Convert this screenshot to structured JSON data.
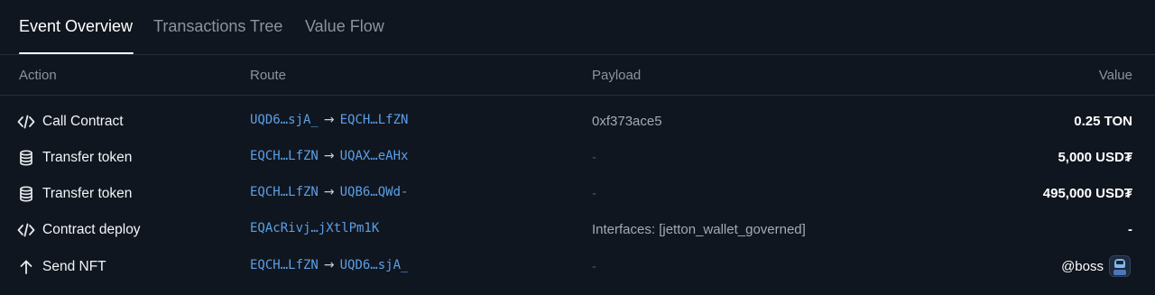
{
  "tabs": [
    {
      "label": "Event Overview",
      "active": true
    },
    {
      "label": "Transactions Tree",
      "active": false
    },
    {
      "label": "Value Flow",
      "active": false
    }
  ],
  "columns": {
    "action": "Action",
    "route": "Route",
    "payload": "Payload",
    "value": "Value"
  },
  "rows": [
    {
      "icon": "code-icon",
      "action": "Call Contract",
      "from": "UQD6…sjA_",
      "to": "EQCH…LfZN",
      "payload": "0xf373ace5",
      "value": "0.25 TON"
    },
    {
      "icon": "database-icon",
      "action": "Transfer token",
      "from": "EQCH…LfZN",
      "to": "UQAX…eAHx",
      "payload": "-",
      "value": "5,000 USD₮"
    },
    {
      "icon": "database-icon",
      "action": "Transfer token",
      "from": "EQCH…LfZN",
      "to": "UQB6…QWd-",
      "payload": "-",
      "value": "495,000 USD₮"
    },
    {
      "icon": "code-icon",
      "action": "Contract deploy",
      "address": "EQAcRivj…jXtlPm1K",
      "payload": "Interfaces: [jetton_wallet_governed]",
      "value": "-"
    },
    {
      "icon": "arrow-up-icon",
      "action": "Send NFT",
      "from": "EQCH…LfZN",
      "to": "UQD6…sjA_",
      "payload": "-",
      "value": "@boss"
    }
  ],
  "route_arrow": "→",
  "colors": {
    "background": "#10161f",
    "link": "#5b9fe6",
    "muted": "#8b93a0",
    "divider": "#262d38"
  }
}
